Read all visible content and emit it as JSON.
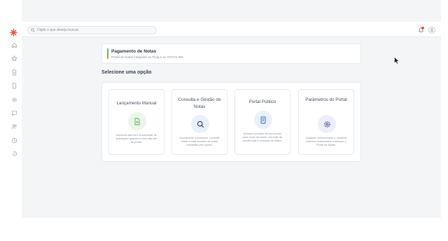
{
  "search": {
    "placeholder": "Digite o que deseja buscar"
  },
  "sidebar": {
    "logo_color": "#e8503a",
    "icons": [
      "home-icon",
      "star-icon",
      "document-icon",
      "file-icon",
      "settings-icon",
      "chat-icon",
      "users-icon",
      "clock-icon",
      "history-icon"
    ]
  },
  "header": {
    "title": "Pagamento de Notas",
    "subtitle": "Portal de Notas integrado ao Fluig e ao TOTVS RM",
    "accent": "#7ab547"
  },
  "section_title": "Selecione uma opção",
  "options": [
    {
      "title": "Lançamento Manual",
      "description": "Abertura interna e encaminhar de solicitação quando a nota não vier do portal.",
      "icon": "file-plus-icon",
      "tint": "#e9f6e8",
      "color": "#5aa84a"
    },
    {
      "title": "Consulta e Gestão de Notas",
      "description": "Acompanhe o processo, consulte notas e trate também as notas recebidas pelo portal.",
      "icon": "search-icon",
      "tint": "#e8f0fb",
      "color": "#2f3a4a"
    },
    {
      "title": "Portal Público",
      "description": "Acesse a jornada do fornecedor para envio de notas, correção de pendências e consulta de status.",
      "icon": "receipt-icon",
      "tint": "#e8f0fb",
      "color": "#2f5fb3"
    },
    {
      "title": "Parâmetros do Portal",
      "description": "Cadastre fornecedores e usuários externos autorizados a acessar o Portal de Notas.",
      "icon": "gear-icon",
      "tint": "#eeeefb",
      "color": "#4a47a8"
    }
  ]
}
